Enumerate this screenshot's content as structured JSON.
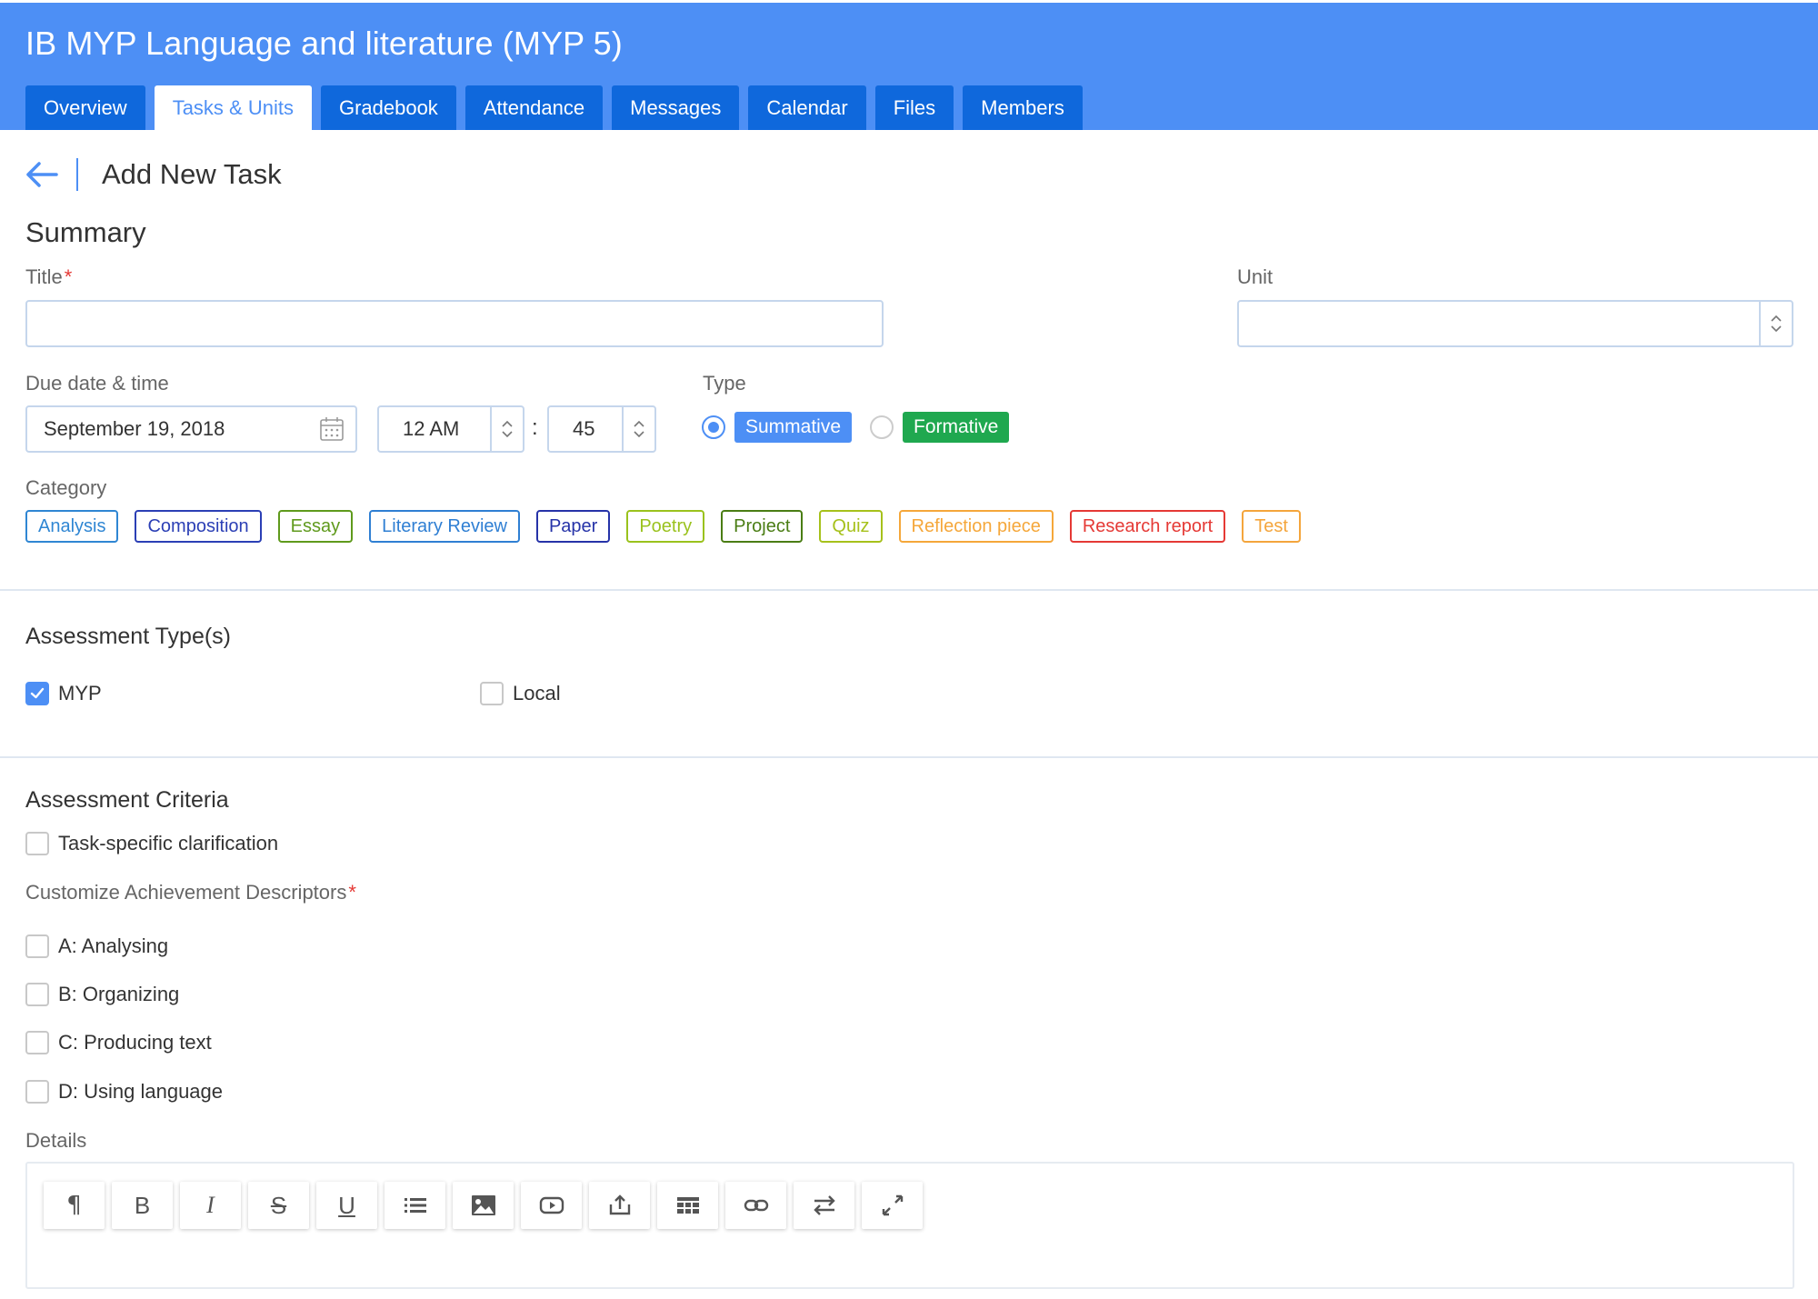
{
  "header": {
    "course_title": "IB MYP Language and literature (MYP 5)",
    "tabs": [
      {
        "label": "Overview",
        "active": false
      },
      {
        "label": "Tasks & Units",
        "active": true
      },
      {
        "label": "Gradebook",
        "active": false
      },
      {
        "label": "Attendance",
        "active": false
      },
      {
        "label": "Messages",
        "active": false
      },
      {
        "label": "Calendar",
        "active": false
      },
      {
        "label": "Files",
        "active": false
      },
      {
        "label": "Members",
        "active": false
      }
    ]
  },
  "page": {
    "title": "Add New Task",
    "back_icon": "arrow-left-icon"
  },
  "summary": {
    "heading": "Summary",
    "title_label": "Title",
    "title_value": "",
    "required_mark": "*",
    "unit_label": "Unit",
    "unit_value": "",
    "due_label": "Due date & time",
    "due_date": "September 19, 2018",
    "hour": "12 AM",
    "colon": ":",
    "minute": "45",
    "type_label": "Type",
    "types": [
      {
        "label": "Summative",
        "selected": true,
        "color": "#4d8ff5"
      },
      {
        "label": "Formative",
        "selected": false,
        "color": "#1fa84f"
      }
    ],
    "category_label": "Category",
    "categories": [
      {
        "label": "Analysis",
        "color": "#2f86d3"
      },
      {
        "label": "Composition",
        "color": "#2b3fb5"
      },
      {
        "label": "Essay",
        "color": "#5f9a1c"
      },
      {
        "label": "Literary Review",
        "color": "#2f7fd3"
      },
      {
        "label": "Paper",
        "color": "#2633a8"
      },
      {
        "label": "Poetry",
        "color": "#9ac21d"
      },
      {
        "label": "Project",
        "color": "#4a7d14"
      },
      {
        "label": "Quiz",
        "color": "#a6c11b"
      },
      {
        "label": "Reflection piece",
        "color": "#f5a73a"
      },
      {
        "label": "Research report",
        "color": "#e53935"
      },
      {
        "label": "Test",
        "color": "#f4a53c"
      }
    ]
  },
  "assessment_types": {
    "heading": "Assessment Type(s)",
    "options": [
      {
        "label": "MYP",
        "checked": true
      },
      {
        "label": "Local",
        "checked": false
      }
    ]
  },
  "assessment_criteria": {
    "heading": "Assessment Criteria",
    "clarification_label": "Task-specific clarification",
    "descriptors_label": "Customize Achievement Descriptors",
    "criteria": [
      {
        "label": "A: Analysing",
        "checked": false
      },
      {
        "label": "B: Organizing",
        "checked": false
      },
      {
        "label": "C: Producing text",
        "checked": false
      },
      {
        "label": "D: Using language",
        "checked": false
      }
    ],
    "details_label": "Details",
    "toolbar": [
      "paragraph-icon",
      "bold-icon",
      "italic-icon",
      "strikethrough-icon",
      "underline-icon",
      "list-icon",
      "image-icon",
      "video-icon",
      "upload-icon",
      "table-icon",
      "link-icon",
      "swap-icon",
      "fullscreen-icon"
    ]
  },
  "colors": {
    "brand": "#4d8ff5",
    "tab_bg": "#0f68dc",
    "required": "#e53935"
  }
}
